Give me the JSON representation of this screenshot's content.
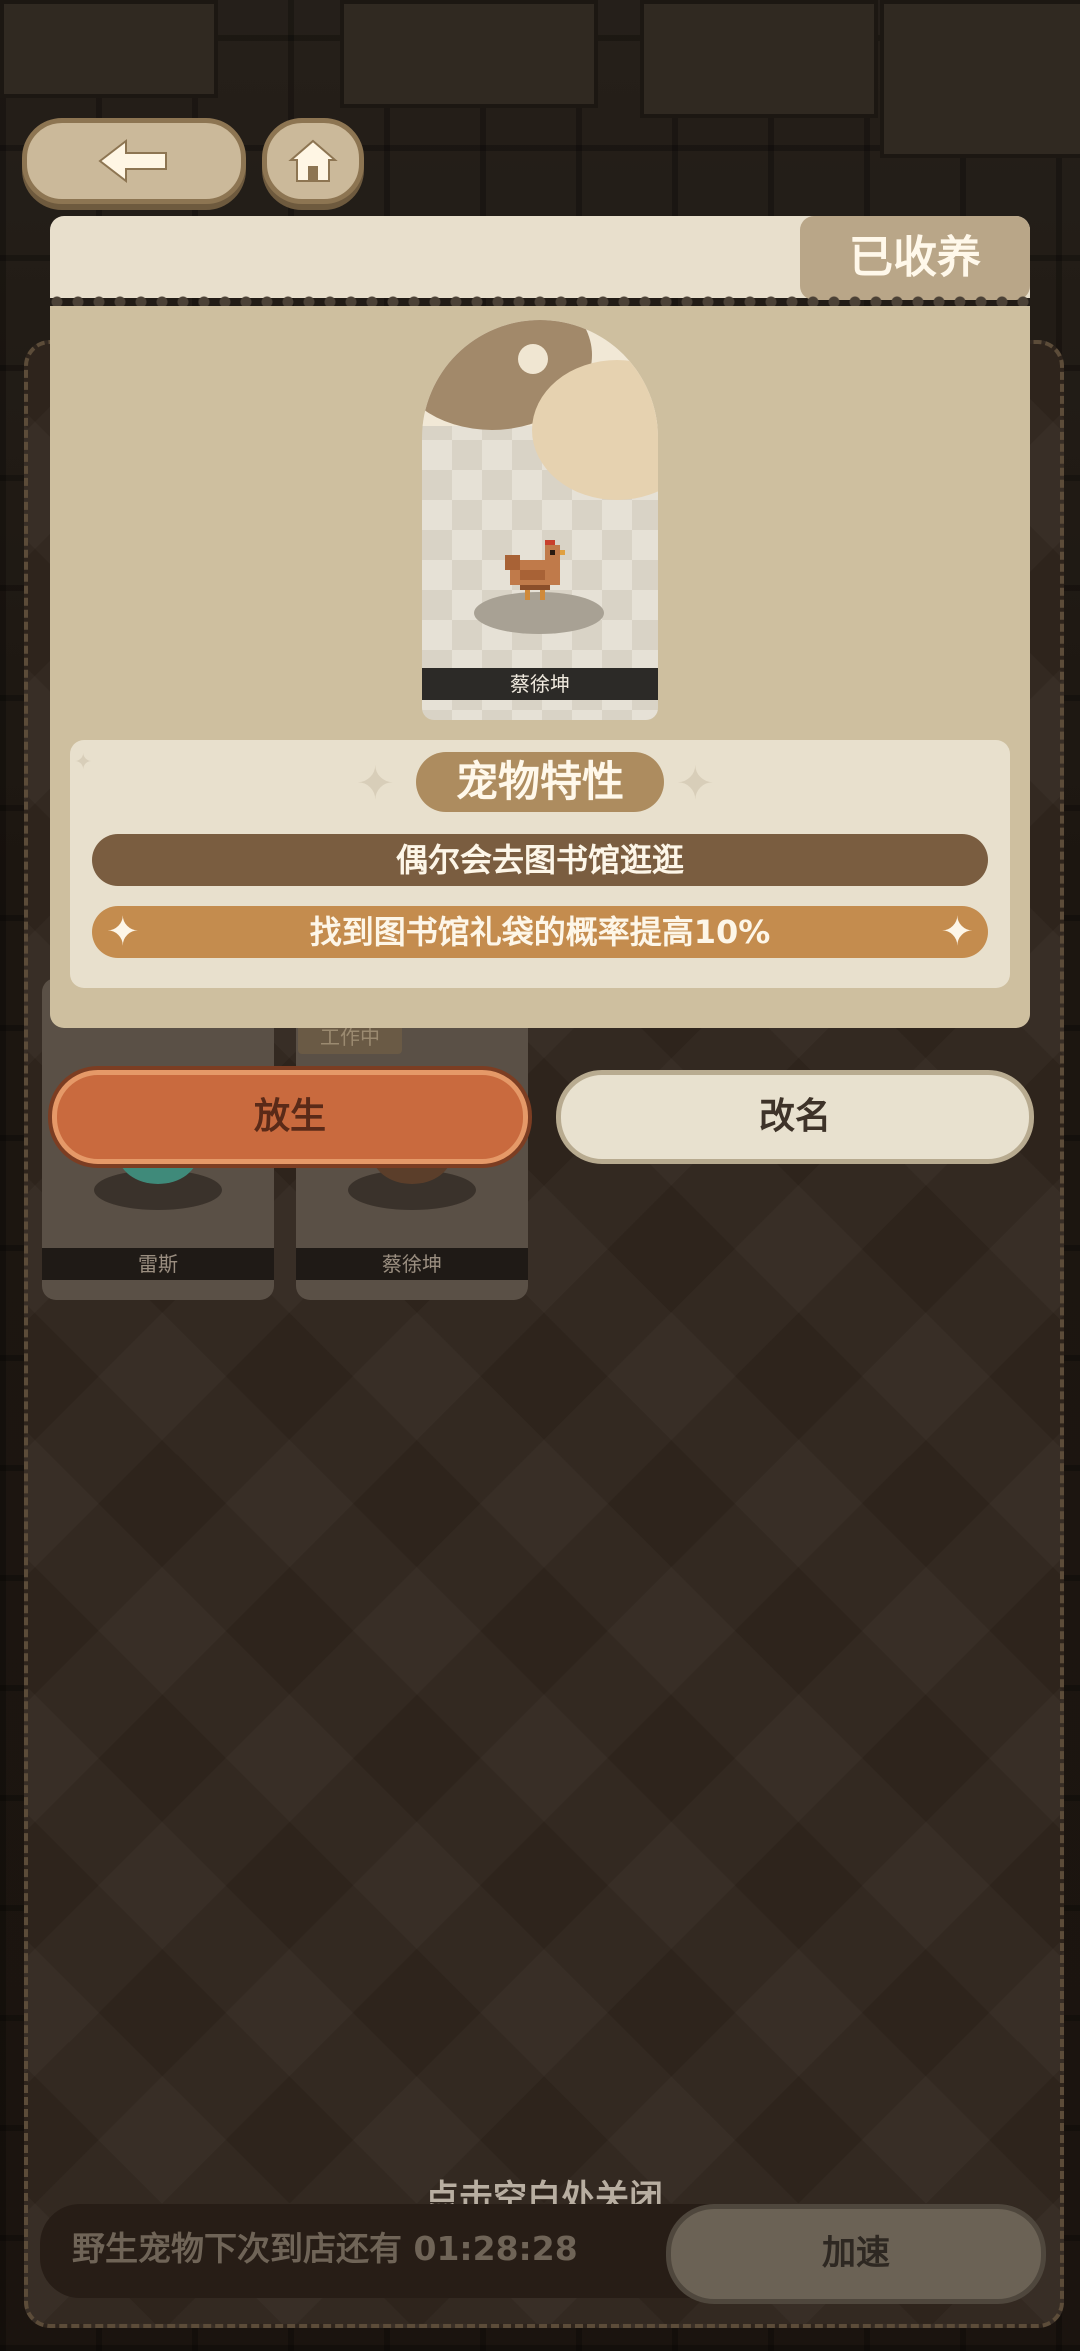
{
  "nav": {
    "back_icon": "arrow-left-icon",
    "home_icon": "house-icon"
  },
  "background_list": {
    "pets": [
      {
        "name": "雷斯",
        "status": ""
      },
      {
        "name": "蔡徐坤",
        "status": "工作中"
      }
    ],
    "close_hint": "点击空白处关闭",
    "wild_pet_text": "野生宠物下次到店还有 01:28:28",
    "speed_up_label": "加速"
  },
  "modal": {
    "adopted_badge": "已收养",
    "pet_name": "蔡徐坤",
    "traits_title": "宠物特性",
    "traits": [
      "偶尔会去图书馆逛逛",
      "找到图书馆礼袋的概率提高10%"
    ],
    "release_label": "放生",
    "rename_label": "改名"
  },
  "colors": {
    "accent_orange": "#c96a3e",
    "trait_dark": "#7a5d40",
    "trait_gold": "#c48c4e",
    "card_bg": "#cebf9f"
  }
}
